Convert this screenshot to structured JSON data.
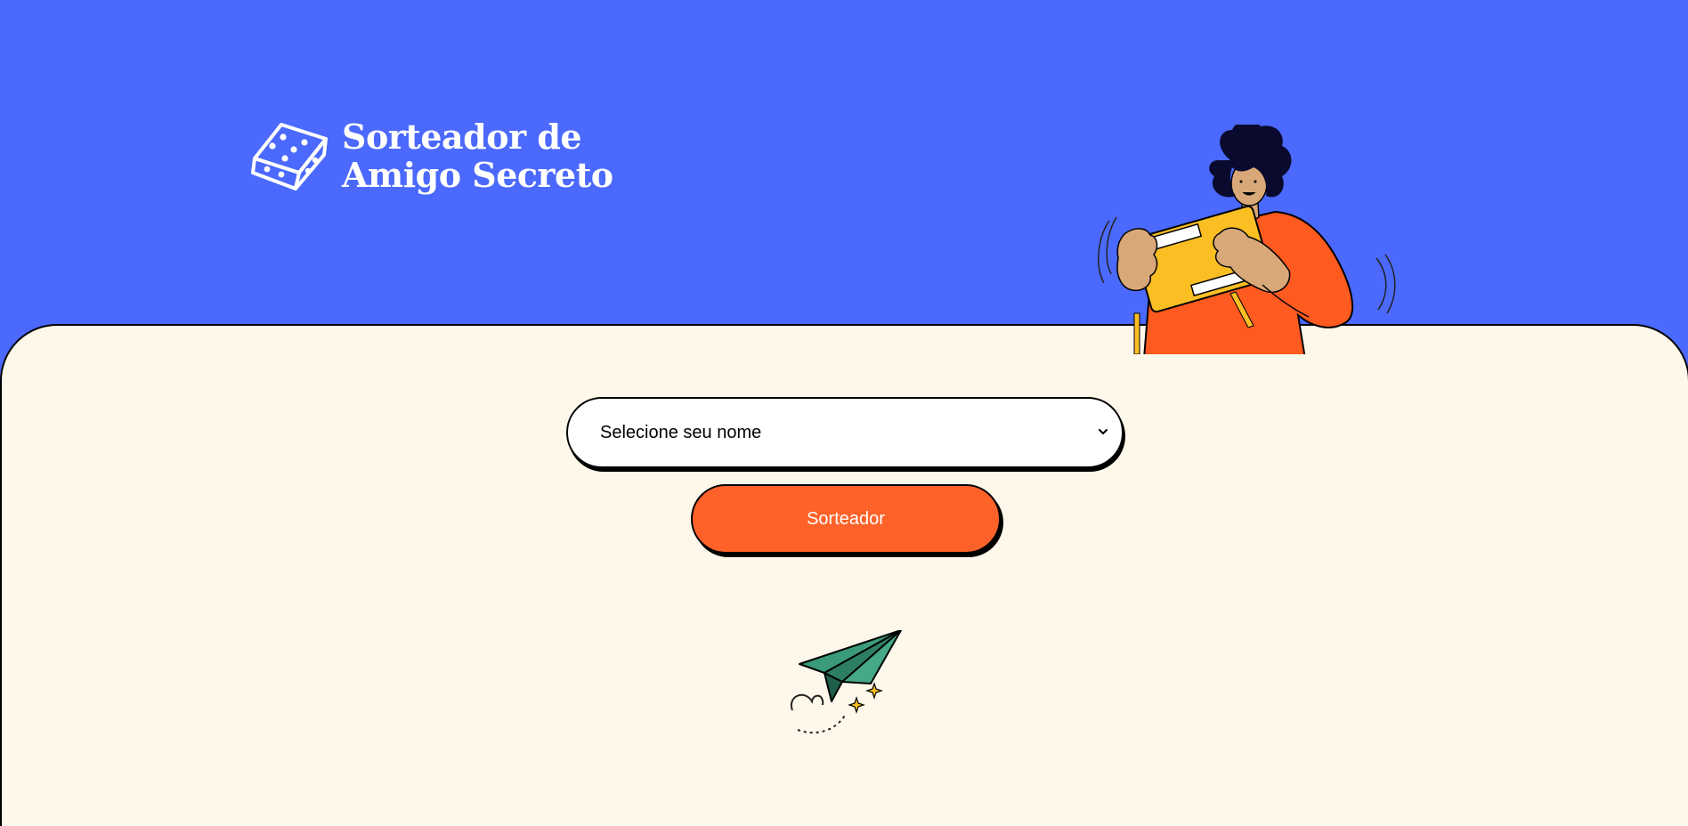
{
  "brand": {
    "title_line1": "Sorteador de",
    "title_line2": "Amigo Secreto",
    "logo_icon": "dice-icon"
  },
  "form": {
    "select": {
      "placeholder_option": "Selecione seu nome"
    },
    "draw_button_label": "Sorteador"
  },
  "illustrations": {
    "hero": "person-holding-ticket-illustration",
    "footer": "paper-plane-illustration"
  },
  "colors": {
    "header_background": "#4b69fd",
    "panel_background": "#fef8ea",
    "button_background": "#ff6229",
    "button_text": "#ffffff"
  }
}
